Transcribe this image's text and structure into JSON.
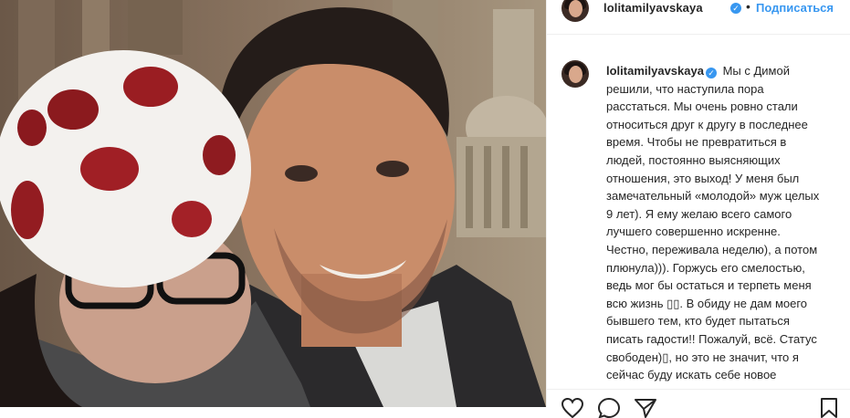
{
  "post": {
    "username": "lolitamilyavskaya",
    "verified_icon": "verified-badge-icon",
    "separator": "•",
    "follow_label": "Подписаться",
    "caption": "Мы с Димой решили, что наступила пора расстаться. Мы очень ровно стали относиться друг к другу в последнее время. Чтобы не превратиться в людей, постоянно выясняющих отношения, это выход! У меня был замечательный «молодой» муж целых 9 лет). Я ему желаю всего самого лучшего совершенно искренне. Честно, переживала неделю), а потом плюнула))). Горжусь его смелостью, ведь мог бы остаться и терпеть меня всю жизнь ▯▯. В обиду не дам моего бывшего тем, кто будет пытаться писать гадости!! Пожалуй, всё. Статус свободен)▯, но это не значит, что я сейчас буду искать себе новое",
    "actions": [
      "heart-icon",
      "comment-icon",
      "share-icon",
      "bookmark-icon"
    ]
  },
  "colors": {
    "accent": "#3897f0",
    "text": "#262626",
    "border": "#efefef"
  }
}
